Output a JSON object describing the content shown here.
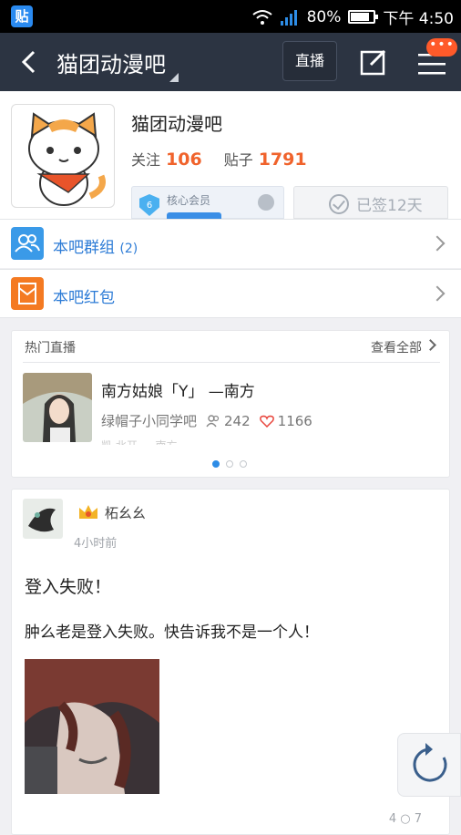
{
  "status_bar": {
    "app_icon_text": "贴",
    "battery": "80%",
    "time": "下午 4:50"
  },
  "nav": {
    "title": "猫团动漫吧",
    "live_button": "直播",
    "menu_badge": "•••"
  },
  "forum": {
    "name": "猫团动漫吧",
    "follow_label": "关注",
    "follow_count": "106",
    "post_label": "贴子",
    "post_count": "1791",
    "member_label": "核心会员",
    "member_level": "6",
    "sign_text": "已签12天"
  },
  "rows": [
    {
      "label": "本吧群组",
      "count": "(2)"
    },
    {
      "label": "本吧红包"
    }
  ],
  "live": {
    "header": "热门直播",
    "see_all": "查看全部",
    "title": "南方姑娘「Y」 —南方",
    "forum": "绿帽子小同学吧",
    "viewers": "242",
    "likes": "1166",
    "cut_text": "凯 北开 … 南方"
  },
  "post": {
    "user": "柘幺幺",
    "time": "4小时前",
    "title": "登入失败！",
    "body": "肿么老是登入失败。快告诉我不是一个人！",
    "footer": "4   ○ 7"
  },
  "colors": {
    "nav_bg": "#2c3442",
    "accent_orange": "#f0632c",
    "link_blue": "#2c7bd6",
    "badge": "#ff5a2a"
  }
}
